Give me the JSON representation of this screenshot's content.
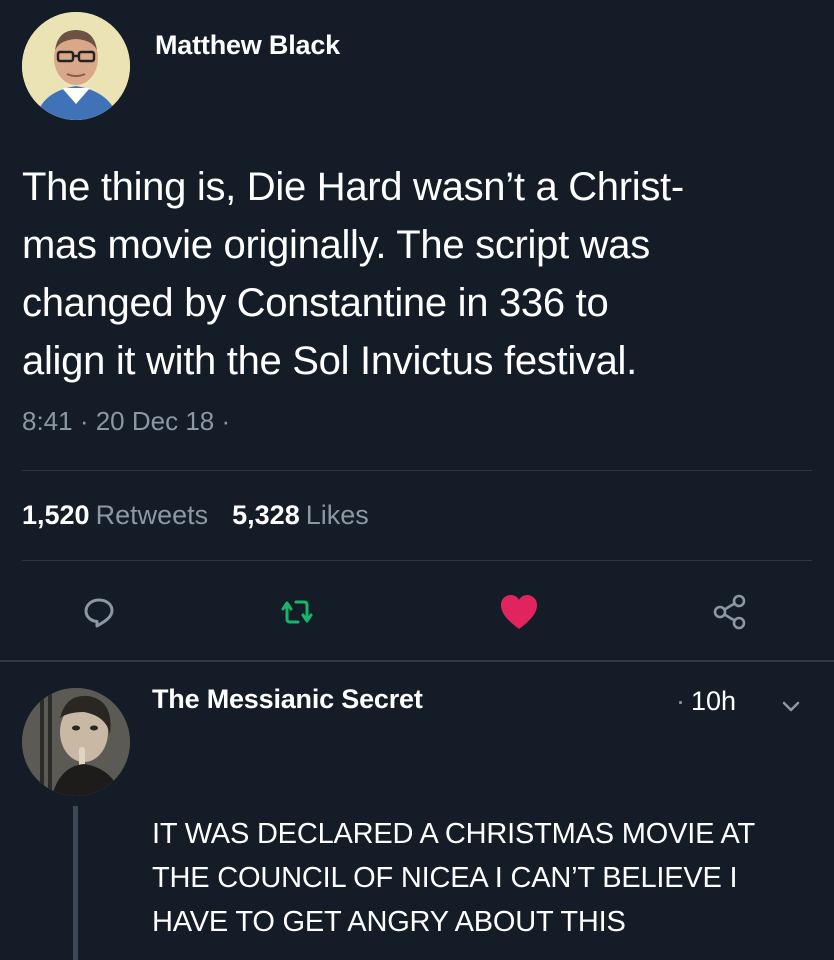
{
  "tweet": {
    "author_name": "Matthew Black",
    "text_lines": [
      "The thing is, Die Hard wasn’t a Christ-",
      "mas movie originally. The script was",
      "changed by Constantine in 336 to",
      "align it with the Sol Invictus festival."
    ],
    "time": "8:41",
    "date": "20 Dec 18",
    "meta_separator": " · ",
    "retweets_count": "1,520",
    "retweets_label": "Retweets",
    "likes_count": "5,328",
    "likes_label": "Likes",
    "liked": true
  },
  "actions": [
    {
      "icon": "reply-icon",
      "color": "#8a97a4"
    },
    {
      "icon": "retweet-icon",
      "color": "#19b36b"
    },
    {
      "icon": "heart-icon",
      "color": "#e0245e"
    },
    {
      "icon": "share-icon",
      "color": "#8a97a4"
    }
  ],
  "reply": {
    "author_name": "The Messianic Secret",
    "time_separator": "·",
    "time": "10h",
    "text_lines": [
      "IT WAS DECLARED A CHRISTMAS MOVIE AT",
      "THE COUNCIL OF NICEA I CAN’T BELIEVE I",
      "HAVE TO GET ANGRY ABOUT THIS"
    ]
  },
  "colors": {
    "background": "#141c27",
    "secondary_text": "#8a97a4",
    "divider": "#2a3744",
    "like": "#e0245e",
    "retweet": "#19b36b"
  }
}
